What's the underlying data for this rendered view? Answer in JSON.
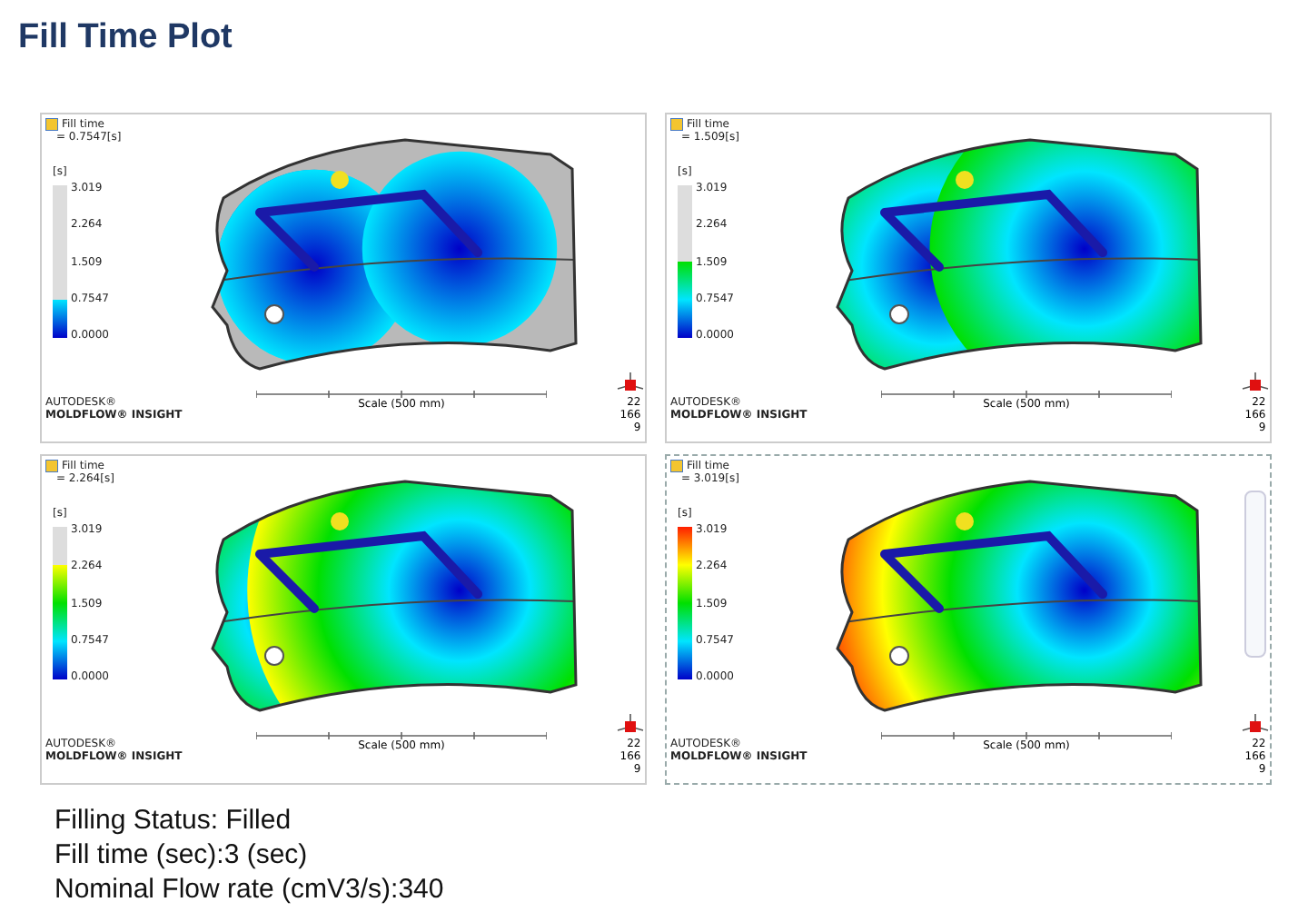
{
  "title": "Fill Time Plot",
  "panels": [
    {
      "result_label": "Fill time",
      "result_value": "= 0.7547[s]",
      "unit": "[s]",
      "ticks": [
        "3.019",
        "2.264",
        "1.509",
        "0.7547",
        "0.0000"
      ],
      "level": 0.25,
      "brand": "AUTODESK®",
      "product": "MOLDFLOW® INSIGHT",
      "scale_label": "Scale (500 mm)",
      "view_numbers": [
        "22",
        "166",
        "9"
      ],
      "nav_toolbar": false
    },
    {
      "result_label": "Fill time",
      "result_value": "= 1.509[s]",
      "unit": "[s]",
      "ticks": [
        "3.019",
        "2.264",
        "1.509",
        "0.7547",
        "0.0000"
      ],
      "level": 0.5,
      "brand": "AUTODESK®",
      "product": "MOLDFLOW® INSIGHT",
      "scale_label": "Scale (500 mm)",
      "view_numbers": [
        "22",
        "166",
        "9"
      ],
      "nav_toolbar": false
    },
    {
      "result_label": "Fill time",
      "result_value": "= 2.264[s]",
      "unit": "[s]",
      "ticks": [
        "3.019",
        "2.264",
        "1.509",
        "0.7547",
        "0.0000"
      ],
      "level": 0.75,
      "brand": "AUTODESK®",
      "product": "MOLDFLOW® INSIGHT",
      "scale_label": "Scale (500 mm)",
      "view_numbers": [
        "22",
        "166",
        "9"
      ],
      "nav_toolbar": false
    },
    {
      "result_label": "Fill time",
      "result_value": "= 3.019[s]",
      "unit": "[s]",
      "ticks": [
        "3.019",
        "2.264",
        "1.509",
        "0.7547",
        "0.0000"
      ],
      "level": 1,
      "brand": "AUTODESK®",
      "product": "MOLDFLOW® INSIGHT",
      "scale_label": "Scale (500 mm)",
      "view_numbers": [
        "22",
        "166",
        "9"
      ],
      "nav_toolbar": true
    }
  ],
  "summary": [
    "Filling Status: Filled",
    "Fill time (sec):3 (sec)",
    "Nominal Flow rate (cmV3/s):340"
  ]
}
